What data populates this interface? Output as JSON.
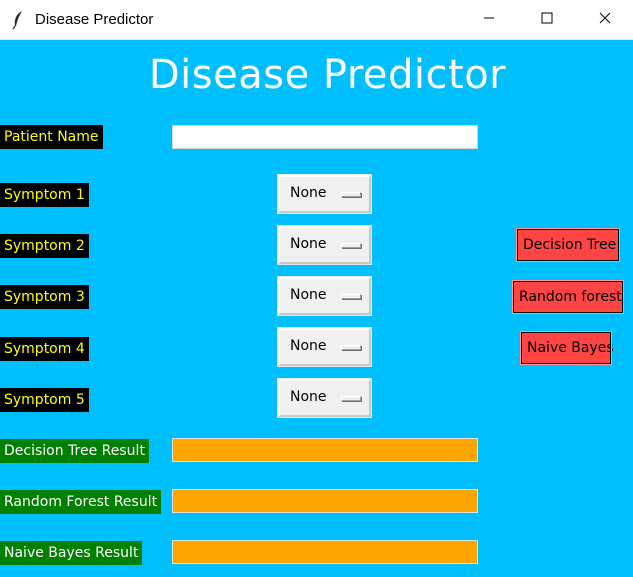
{
  "window": {
    "title": "Disease Predictor",
    "minimize_glyph": "—",
    "maximize_glyph": "☐",
    "close_glyph": "✕"
  },
  "heading": "Disease Predictor",
  "labels": {
    "patient_name": "Patient Name",
    "symptom1": "Symptom 1",
    "symptom2": "Symptom 2",
    "symptom3": "Symptom 3",
    "symptom4": "Symptom 4",
    "symptom5": "Symptom 5",
    "dt_result": "Decision Tree Result",
    "rf_result": "Random Forest Result",
    "nb_result": "Naive Bayes Result"
  },
  "inputs": {
    "patient_name": "",
    "dt_result": "",
    "rf_result": "",
    "nb_result": ""
  },
  "symptoms": {
    "symptom1": "None",
    "symptom2": "None",
    "symptom3": "None",
    "symptom4": "None",
    "symptom5": "None"
  },
  "buttons": {
    "decision_tree": "Decision Tree",
    "random_forest": "Random forest",
    "naive_bayes": "Naive Bayes"
  },
  "colors": {
    "background": "#00bfff",
    "label_black_bg": "#000000",
    "label_black_text": "#ffff00",
    "label_green_bg": "#008000",
    "label_green_text": "#ffffff",
    "result_field": "#ffa500",
    "button": "#ff4444"
  },
  "icons": {
    "app": "feather-icon",
    "minimize": "minimize-icon",
    "maximize": "maximize-icon",
    "close": "close-icon"
  }
}
